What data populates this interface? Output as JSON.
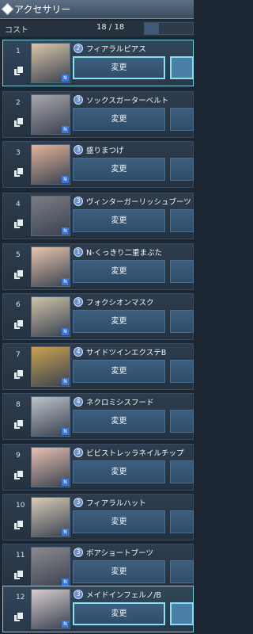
{
  "header": {
    "title": "アクセサリー"
  },
  "cost": {
    "label": "コスト",
    "value": "18 / 18",
    "fill_fraction": 0.3
  },
  "slots": [
    {
      "num": "1",
      "rank": "2",
      "name": "フィアラルピアス",
      "button": "変更",
      "thumb_color": "#d9c7a8"
    },
    {
      "num": "2",
      "rank": "3",
      "name": "ソックスガーターベルト",
      "button": "変更",
      "thumb_color": "#a9a6ad"
    },
    {
      "num": "3",
      "rank": "3",
      "name": "盛りまつげ",
      "button": "変更",
      "thumb_color": "#e2b39a"
    },
    {
      "num": "4",
      "rank": "3",
      "name": "ヴィンターガーリッシュブーツ",
      "button": "変更",
      "thumb_color": "#7a7d86"
    },
    {
      "num": "5",
      "rank": "1",
      "name": "N-くっきり二重まぶた",
      "button": "変更",
      "thumb_color": "#e9c6ad"
    },
    {
      "num": "6",
      "rank": "3",
      "name": "フォクシオンマスク",
      "button": "変更",
      "thumb_color": "#cfc3a9"
    },
    {
      "num": "7",
      "rank": "4",
      "name": "サイドツインエクステB",
      "button": "変更",
      "thumb_color": "#c9a24f"
    },
    {
      "num": "8",
      "rank": "4",
      "name": "ネクロミシスフード",
      "button": "変更",
      "thumb_color": "#bcc3c9"
    },
    {
      "num": "9",
      "rank": "3",
      "name": "ビビストレッラネイルチップ",
      "button": "変更",
      "thumb_color": "#e8bfb1"
    },
    {
      "num": "10",
      "rank": "3",
      "name": "フィアラルハット",
      "button": "変更",
      "thumb_color": "#d8cdb7"
    },
    {
      "num": "11",
      "rank": "3",
      "name": "ボアショートブーツ",
      "button": "変更",
      "thumb_color": "#8d8a8f"
    },
    {
      "num": "12",
      "rank": "3",
      "name": "メイドインフェルノ/B",
      "button": "変更",
      "thumb_color": "#d7cdd0"
    }
  ],
  "colors": {
    "selected_border": "#7ad2e0",
    "button": "#3d5f7f",
    "background": "#1c2633"
  }
}
